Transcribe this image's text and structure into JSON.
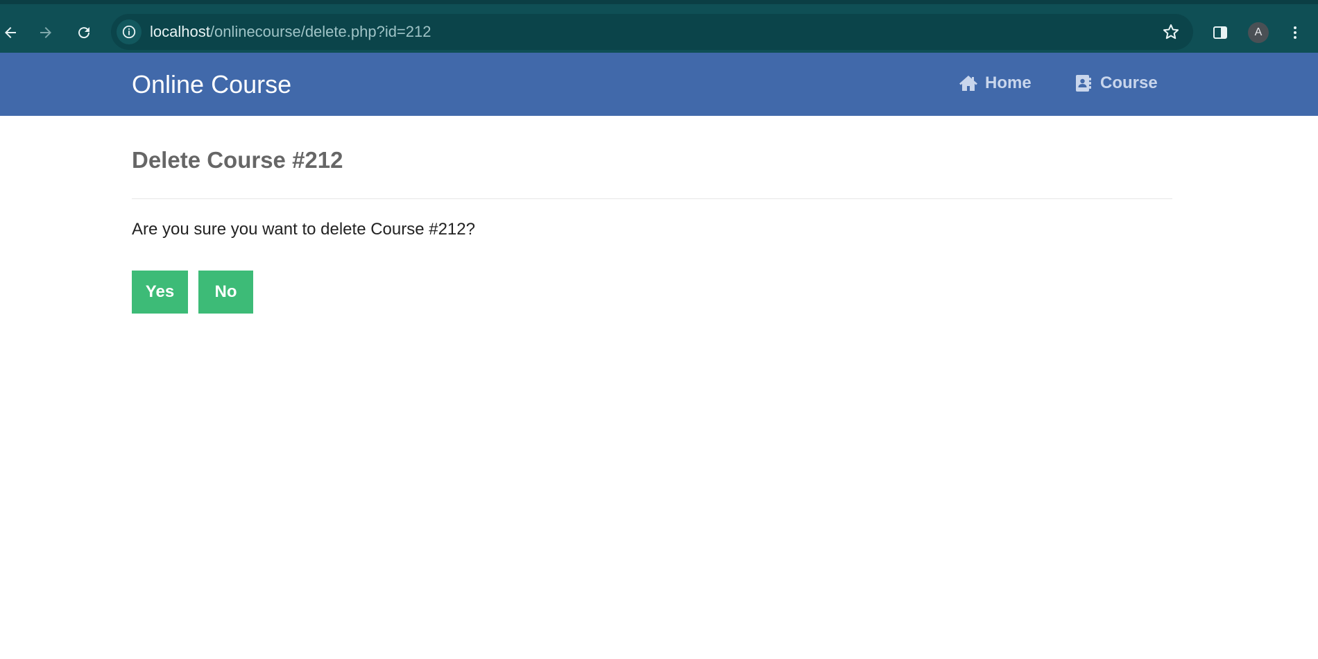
{
  "browser": {
    "url_host": "localhost",
    "url_path": "/onlinecourse/delete.php?id=212",
    "profile_initial": "A"
  },
  "icons": {
    "back": "back-arrow-icon",
    "forward": "forward-arrow-icon",
    "reload": "reload-icon",
    "site_info": "info-icon",
    "bookmark": "star-icon",
    "side_panel": "side-panel-icon",
    "menu": "kebab-menu-icon",
    "home": "home-icon",
    "course": "address-book-icon"
  },
  "navbar": {
    "brand": "Online Course",
    "links": [
      {
        "label": "Home"
      },
      {
        "label": "Course"
      }
    ]
  },
  "main": {
    "title": "Delete Course #212",
    "message": "Are you sure you want to delete Course #212?",
    "yes_label": "Yes",
    "no_label": "No"
  },
  "colors": {
    "browser_bar": "#0f4f55",
    "navbar": "#4169aa",
    "button": "#3dbb77",
    "title_text": "#666666"
  }
}
